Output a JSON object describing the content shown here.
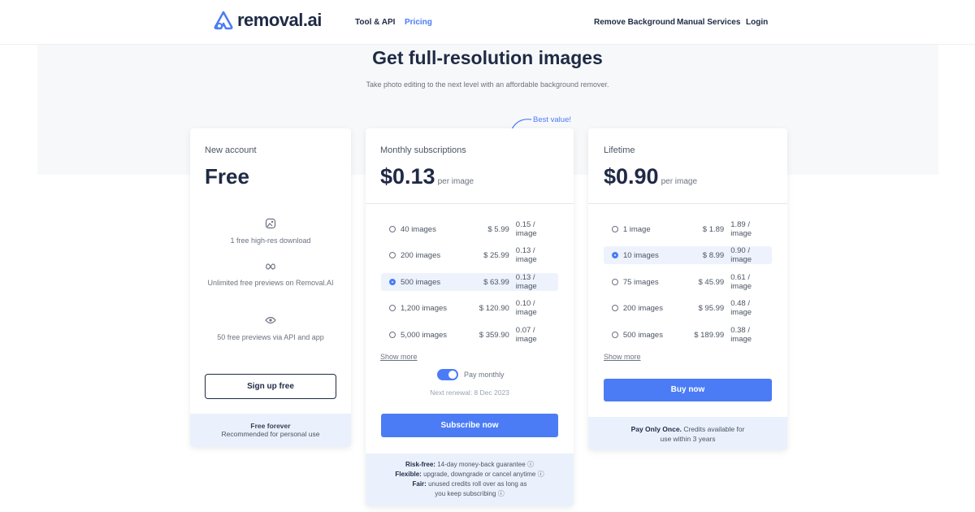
{
  "nav": {
    "logo_text": "removal.ai",
    "tool_api": "Tool & API",
    "pricing": "Pricing",
    "remove_background": "Remove Background",
    "manual_services": "Manual Services",
    "login": "Login"
  },
  "hero": {
    "title": "Get full-resolution images",
    "subtitle": "Take photo editing to the next level with an affordable background remover."
  },
  "free": {
    "head": "New account",
    "price": "Free",
    "features": [
      {
        "icon": "image-icon",
        "text": "1 free high-res download"
      },
      {
        "icon": "infinity-icon",
        "text": "Unlimited free previews on Removal.AI"
      },
      {
        "icon": "eye-icon",
        "text": "50 free previews via API and app"
      }
    ],
    "button": "Sign up free",
    "foot_title": "Free forever",
    "foot_sub": "Recommended for personal use"
  },
  "monthly": {
    "badge": "Best value!",
    "head": "Monthly subscriptions",
    "price": "$0.13",
    "per": "per image",
    "options": [
      {
        "count": "40 images",
        "price": "$ 5.99",
        "unit": "0.15 / image",
        "selected": false
      },
      {
        "count": "200 images",
        "price": "$ 25.99",
        "unit": "0.13 / image",
        "selected": false
      },
      {
        "count": "500 images",
        "price": "$ 63.99",
        "unit": "0.13 / image",
        "selected": true
      },
      {
        "count": "1,200 images",
        "price": "$ 120.90",
        "unit": "0.10 / image",
        "selected": false
      },
      {
        "count": "5,000 images",
        "price": "$ 359.90",
        "unit": "0.07 / image",
        "selected": false
      }
    ],
    "show_more": "Show more",
    "toggle_label": "Pay monthly",
    "renewal": "Next renewal: 8 Dec 2023",
    "button": "Subscribe now",
    "foot": [
      {
        "bold": "Risk-free:",
        "text": "14-day money-back guarantee"
      },
      {
        "bold": "Flexible:",
        "text": "upgrade, downgrade or cancel anytime"
      },
      {
        "bold": "Fair:",
        "text": "unused credits roll over as long as you keep subscribing"
      }
    ]
  },
  "lifetime": {
    "head": "Lifetime",
    "price": "$0.90",
    "per": "per image",
    "options": [
      {
        "count": "1 image",
        "price": "$ 1.89",
        "unit": "1.89 / image",
        "selected": false
      },
      {
        "count": "10 images",
        "price": "$ 8.99",
        "unit": "0.90 / image",
        "selected": true
      },
      {
        "count": "75 images",
        "price": "$ 45.99",
        "unit": "0.61 / image",
        "selected": false
      },
      {
        "count": "200 images",
        "price": "$ 95.99",
        "unit": "0.48 / image",
        "selected": false
      },
      {
        "count": "500 images",
        "price": "$ 189.99",
        "unit": "0.38 / image",
        "selected": false
      }
    ],
    "show_more": "Show more",
    "button": "Buy now",
    "foot_bold": "Pay Only Once.",
    "foot_text": "Credits available for use within 3 years"
  },
  "colors": {
    "accent": "#4b7cf6",
    "foot_bg": "#eaf1fc"
  }
}
